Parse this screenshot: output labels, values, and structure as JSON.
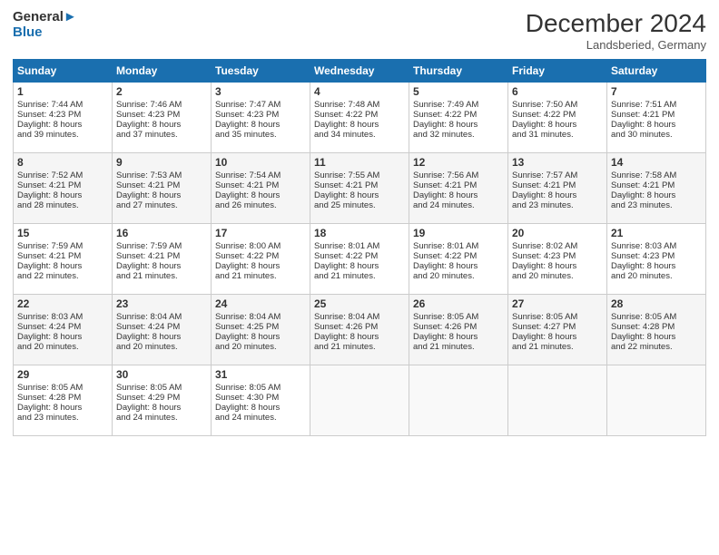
{
  "header": {
    "logo_line1": "General",
    "logo_line2": "Blue",
    "month": "December 2024",
    "location": "Landsberied, Germany"
  },
  "days_of_week": [
    "Sunday",
    "Monday",
    "Tuesday",
    "Wednesday",
    "Thursday",
    "Friday",
    "Saturday"
  ],
  "weeks": [
    [
      {
        "day": "1",
        "lines": [
          "Sunrise: 7:44 AM",
          "Sunset: 4:23 PM",
          "Daylight: 8 hours",
          "and 39 minutes."
        ]
      },
      {
        "day": "2",
        "lines": [
          "Sunrise: 7:46 AM",
          "Sunset: 4:23 PM",
          "Daylight: 8 hours",
          "and 37 minutes."
        ]
      },
      {
        "day": "3",
        "lines": [
          "Sunrise: 7:47 AM",
          "Sunset: 4:23 PM",
          "Daylight: 8 hours",
          "and 35 minutes."
        ]
      },
      {
        "day": "4",
        "lines": [
          "Sunrise: 7:48 AM",
          "Sunset: 4:22 PM",
          "Daylight: 8 hours",
          "and 34 minutes."
        ]
      },
      {
        "day": "5",
        "lines": [
          "Sunrise: 7:49 AM",
          "Sunset: 4:22 PM",
          "Daylight: 8 hours",
          "and 32 minutes."
        ]
      },
      {
        "day": "6",
        "lines": [
          "Sunrise: 7:50 AM",
          "Sunset: 4:22 PM",
          "Daylight: 8 hours",
          "and 31 minutes."
        ]
      },
      {
        "day": "7",
        "lines": [
          "Sunrise: 7:51 AM",
          "Sunset: 4:21 PM",
          "Daylight: 8 hours",
          "and 30 minutes."
        ]
      }
    ],
    [
      {
        "day": "8",
        "lines": [
          "Sunrise: 7:52 AM",
          "Sunset: 4:21 PM",
          "Daylight: 8 hours",
          "and 28 minutes."
        ]
      },
      {
        "day": "9",
        "lines": [
          "Sunrise: 7:53 AM",
          "Sunset: 4:21 PM",
          "Daylight: 8 hours",
          "and 27 minutes."
        ]
      },
      {
        "day": "10",
        "lines": [
          "Sunrise: 7:54 AM",
          "Sunset: 4:21 PM",
          "Daylight: 8 hours",
          "and 26 minutes."
        ]
      },
      {
        "day": "11",
        "lines": [
          "Sunrise: 7:55 AM",
          "Sunset: 4:21 PM",
          "Daylight: 8 hours",
          "and 25 minutes."
        ]
      },
      {
        "day": "12",
        "lines": [
          "Sunrise: 7:56 AM",
          "Sunset: 4:21 PM",
          "Daylight: 8 hours",
          "and 24 minutes."
        ]
      },
      {
        "day": "13",
        "lines": [
          "Sunrise: 7:57 AM",
          "Sunset: 4:21 PM",
          "Daylight: 8 hours",
          "and 23 minutes."
        ]
      },
      {
        "day": "14",
        "lines": [
          "Sunrise: 7:58 AM",
          "Sunset: 4:21 PM",
          "Daylight: 8 hours",
          "and 23 minutes."
        ]
      }
    ],
    [
      {
        "day": "15",
        "lines": [
          "Sunrise: 7:59 AM",
          "Sunset: 4:21 PM",
          "Daylight: 8 hours",
          "and 22 minutes."
        ]
      },
      {
        "day": "16",
        "lines": [
          "Sunrise: 7:59 AM",
          "Sunset: 4:21 PM",
          "Daylight: 8 hours",
          "and 21 minutes."
        ]
      },
      {
        "day": "17",
        "lines": [
          "Sunrise: 8:00 AM",
          "Sunset: 4:22 PM",
          "Daylight: 8 hours",
          "and 21 minutes."
        ]
      },
      {
        "day": "18",
        "lines": [
          "Sunrise: 8:01 AM",
          "Sunset: 4:22 PM",
          "Daylight: 8 hours",
          "and 21 minutes."
        ]
      },
      {
        "day": "19",
        "lines": [
          "Sunrise: 8:01 AM",
          "Sunset: 4:22 PM",
          "Daylight: 8 hours",
          "and 20 minutes."
        ]
      },
      {
        "day": "20",
        "lines": [
          "Sunrise: 8:02 AM",
          "Sunset: 4:23 PM",
          "Daylight: 8 hours",
          "and 20 minutes."
        ]
      },
      {
        "day": "21",
        "lines": [
          "Sunrise: 8:03 AM",
          "Sunset: 4:23 PM",
          "Daylight: 8 hours",
          "and 20 minutes."
        ]
      }
    ],
    [
      {
        "day": "22",
        "lines": [
          "Sunrise: 8:03 AM",
          "Sunset: 4:24 PM",
          "Daylight: 8 hours",
          "and 20 minutes."
        ]
      },
      {
        "day": "23",
        "lines": [
          "Sunrise: 8:04 AM",
          "Sunset: 4:24 PM",
          "Daylight: 8 hours",
          "and 20 minutes."
        ]
      },
      {
        "day": "24",
        "lines": [
          "Sunrise: 8:04 AM",
          "Sunset: 4:25 PM",
          "Daylight: 8 hours",
          "and 20 minutes."
        ]
      },
      {
        "day": "25",
        "lines": [
          "Sunrise: 8:04 AM",
          "Sunset: 4:26 PM",
          "Daylight: 8 hours",
          "and 21 minutes."
        ]
      },
      {
        "day": "26",
        "lines": [
          "Sunrise: 8:05 AM",
          "Sunset: 4:26 PM",
          "Daylight: 8 hours",
          "and 21 minutes."
        ]
      },
      {
        "day": "27",
        "lines": [
          "Sunrise: 8:05 AM",
          "Sunset: 4:27 PM",
          "Daylight: 8 hours",
          "and 21 minutes."
        ]
      },
      {
        "day": "28",
        "lines": [
          "Sunrise: 8:05 AM",
          "Sunset: 4:28 PM",
          "Daylight: 8 hours",
          "and 22 minutes."
        ]
      }
    ],
    [
      {
        "day": "29",
        "lines": [
          "Sunrise: 8:05 AM",
          "Sunset: 4:28 PM",
          "Daylight: 8 hours",
          "and 23 minutes."
        ]
      },
      {
        "day": "30",
        "lines": [
          "Sunrise: 8:05 AM",
          "Sunset: 4:29 PM",
          "Daylight: 8 hours",
          "and 24 minutes."
        ]
      },
      {
        "day": "31",
        "lines": [
          "Sunrise: 8:05 AM",
          "Sunset: 4:30 PM",
          "Daylight: 8 hours",
          "and 24 minutes."
        ]
      },
      {
        "day": "",
        "lines": []
      },
      {
        "day": "",
        "lines": []
      },
      {
        "day": "",
        "lines": []
      },
      {
        "day": "",
        "lines": []
      }
    ]
  ]
}
